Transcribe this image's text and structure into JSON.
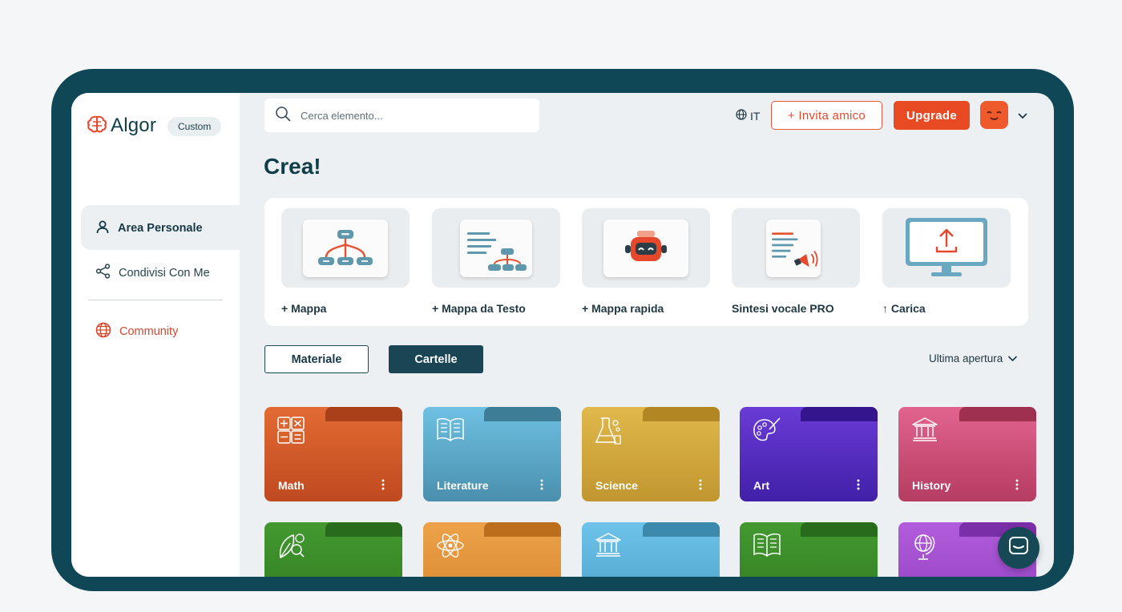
{
  "brand": {
    "name": "Algor",
    "plan": "Custom"
  },
  "sidebar": {
    "items": [
      {
        "label": "Area Personale",
        "icon": "user-icon"
      },
      {
        "label": "Condivisi Con Me",
        "icon": "share-icon"
      },
      {
        "label": "Community",
        "icon": "globe-icon"
      }
    ]
  },
  "topbar": {
    "search_placeholder": "Cerca elemento...",
    "language": "IT",
    "invite_label": "+ Invita amico",
    "upgrade_label": "Upgrade"
  },
  "page": {
    "title": "Crea!"
  },
  "create_items": [
    {
      "label": "+ Mappa",
      "icon": "mind-map-icon"
    },
    {
      "label": "+ Mappa da Testo",
      "icon": "text-to-map-icon"
    },
    {
      "label": "+ Mappa rapida",
      "icon": "robot-icon"
    },
    {
      "label": "Sintesi vocale PRO",
      "icon": "text-to-speech-icon"
    },
    {
      "label": "↑ Carica",
      "icon": "upload-monitor-icon"
    }
  ],
  "view_toggle": {
    "materiale": "Materiale",
    "cartelle": "Cartelle",
    "active": "Cartelle"
  },
  "sort": {
    "label": "Ultima apertura"
  },
  "folders": [
    {
      "name": "Math",
      "icon": "calculator-icon",
      "color": "#d9622c"
    },
    {
      "name": "Literature",
      "icon": "book-icon",
      "color": "#5fb1d4"
    },
    {
      "name": "Science",
      "icon": "flask-icon",
      "color": "#d7ac3e"
    },
    {
      "name": "Art",
      "icon": "palette-icon",
      "color": "#5a2fc0"
    },
    {
      "name": "History",
      "icon": "museum-icon",
      "color": "#d45580"
    },
    {
      "name": "",
      "icon": "leaf-search-icon",
      "color": "#3e8c2c"
    },
    {
      "name": "",
      "icon": "atom-icon",
      "color": "#e3973c"
    },
    {
      "name": "",
      "icon": "museum-icon",
      "color": "#5db4de"
    },
    {
      "name": "",
      "icon": "book-icon",
      "color": "#3e8c2c"
    },
    {
      "name": "",
      "icon": "globe-stand-icon",
      "color": "#a94fd2"
    }
  ],
  "colors": {
    "primary_dark": "#0f4756",
    "accent": "#e84b24"
  }
}
